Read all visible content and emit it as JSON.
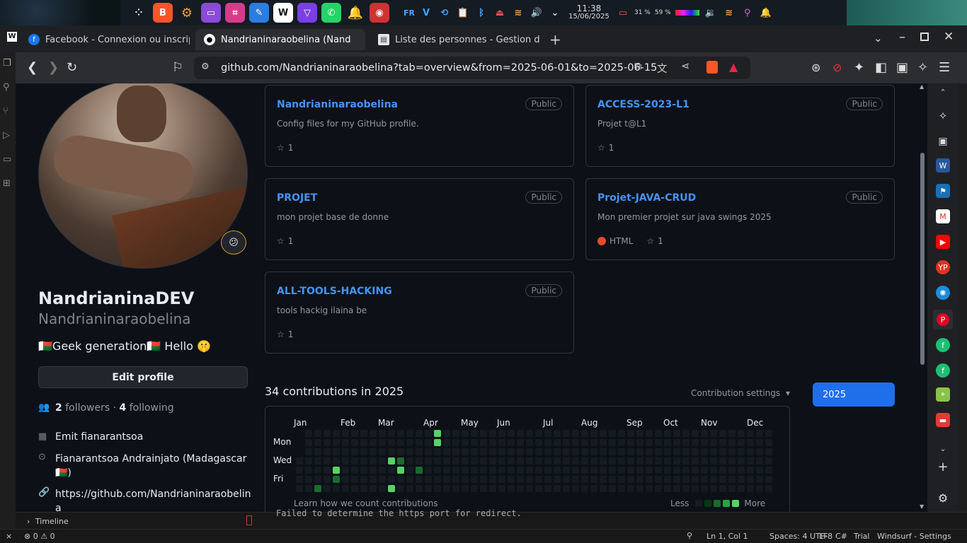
{
  "os": {
    "time": "11:38",
    "date": "15/06/2025",
    "lang": "FR",
    "cpu": "31 %",
    "mem": "59 %"
  },
  "tabs": [
    {
      "label": "Facebook - Connexion ou inscrip",
      "icon": "facebook-icon"
    },
    {
      "label": "Nandrianinaraobelina (Nand",
      "icon": "github-icon"
    },
    {
      "label": "Liste des personnes - Gestion de",
      "icon": "document-icon"
    }
  ],
  "url": "github.com/Nandrianinaraobelina?tab=overview&from=2025-06-01&to=2025-06-15",
  "profile": {
    "name": "NandrianinaDEV",
    "login": "Nandrianinaraobelina",
    "bio": "🇲🇬Geek generation🇲🇬 Hello 🤫",
    "edit_label": "Edit profile",
    "followers_count": "2",
    "followers_label": "followers",
    "following_count": "4",
    "following_label": "following",
    "org": "Emit fianarantsoa",
    "location": "Fianarantsoa Andrainjato (Madagascar",
    "location2": "🇲🇬)",
    "website": "https://github.com/Nandrianinaraobelin",
    "website2": "a"
  },
  "repos": [
    {
      "name": "Nandrianinaraobelina",
      "visibility": "Public",
      "desc": "Config files for my GitHub profile.",
      "stars": "1",
      "lang": ""
    },
    {
      "name": "ACCESS-2023-L1",
      "visibility": "Public",
      "desc": "Projet t@L1",
      "stars": "1",
      "lang": ""
    },
    {
      "name": "PROJET",
      "visibility": "Public",
      "desc": "mon projet base de donne",
      "stars": "1",
      "lang": ""
    },
    {
      "name": "Projet-JAVA-CRUD",
      "visibility": "Public",
      "desc": "Mon premier projet sur java swings 2025",
      "stars": "1",
      "lang": "HTML"
    },
    {
      "name": "ALL-TOOLS-HACKING",
      "visibility": "Public",
      "desc": "tools hackig ilaina be",
      "stars": "1",
      "lang": ""
    }
  ],
  "contributions": {
    "title": "34 contributions in 2025",
    "settings_label": "Contribution settings",
    "year": "2025",
    "months": [
      "Jan",
      "Feb",
      "Mar",
      "Apr",
      "May",
      "Jun",
      "Jul",
      "Aug",
      "Sep",
      "Oct",
      "Nov",
      "Dec"
    ],
    "days": [
      "Mon",
      "Wed",
      "Fri"
    ],
    "learn": "Learn how we count contributions",
    "less": "Less",
    "more": "More",
    "active_cells": [
      {
        "week": 2,
        "day": 6,
        "level": 2
      },
      {
        "week": 4,
        "day": 4,
        "level": 4
      },
      {
        "week": 4,
        "day": 5,
        "level": 2
      },
      {
        "week": 10,
        "day": 3,
        "level": 4
      },
      {
        "week": 10,
        "day": 6,
        "level": 4
      },
      {
        "week": 11,
        "day": 3,
        "level": 2
      },
      {
        "week": 11,
        "day": 4,
        "level": 4
      },
      {
        "week": 13,
        "day": 4,
        "level": 2
      },
      {
        "week": 15,
        "day": 0,
        "level": 4
      },
      {
        "week": 15,
        "day": 1,
        "level": 4
      }
    ]
  },
  "terminal_line": "Failed to determine the https port for redirect.",
  "timeline_label": "Timeline",
  "status": {
    "problems": "⊗ 0 ⚠ 0",
    "position": "Ln 1, Col 1",
    "spaces": "Spaces: 4",
    "encoding": "UTF-8",
    "eol": "LF",
    "lang": "C#",
    "trial": "Trial",
    "windsurf": "Windsurf - Settings"
  },
  "colors": {
    "accent": "#4493f8",
    "button": "#1f6feb",
    "level1": "#033a16",
    "level2": "#196c2e",
    "level3": "#2ea043",
    "level4": "#56d364"
  }
}
